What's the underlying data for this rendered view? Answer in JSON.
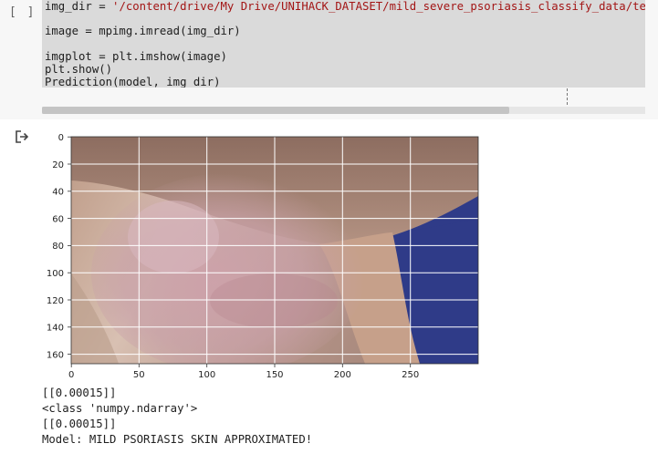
{
  "cell": {
    "run_indicator": "[ ]",
    "code": [
      {
        "prefix": "img_dir = ",
        "string": "'/content/drive/My Drive/UNIHACK_DATASET/mild_severe_psoriasis_classify_data/test/"
      },
      {
        "prefix": "",
        "string": ""
      },
      {
        "prefix": "image = mpimg.imread(img_dir)",
        "string": ""
      },
      {
        "prefix": "",
        "string": ""
      },
      {
        "prefix": "imgplot = plt.imshow(image)",
        "string": ""
      },
      {
        "prefix": "plt.show()",
        "string": ""
      },
      {
        "prefix": "Prediction(model, img_dir)",
        "string": ""
      }
    ]
  },
  "output": {
    "icon": "output-redirect-icon",
    "plot": {
      "x_ticks": [
        "0",
        "50",
        "100",
        "150",
        "200",
        "250"
      ],
      "y_ticks": [
        "0",
        "20",
        "40",
        "60",
        "80",
        "100",
        "120",
        "140",
        "160"
      ],
      "xlim": [
        0,
        300
      ],
      "ylim": [
        167,
        0
      ],
      "grid": true,
      "image_description_colors": {
        "skin_light": "#cfae9c",
        "skin_shadow": "#8a6a5c",
        "plaque": "#d3a7ae",
        "background": "#2e3a86"
      }
    },
    "lines": [
      "[[0.00015]]",
      "<class 'numpy.ndarray'>",
      "[[0.00015]]",
      "Model: MILD PSORIASIS SKIN APPROXIMATED!"
    ]
  }
}
